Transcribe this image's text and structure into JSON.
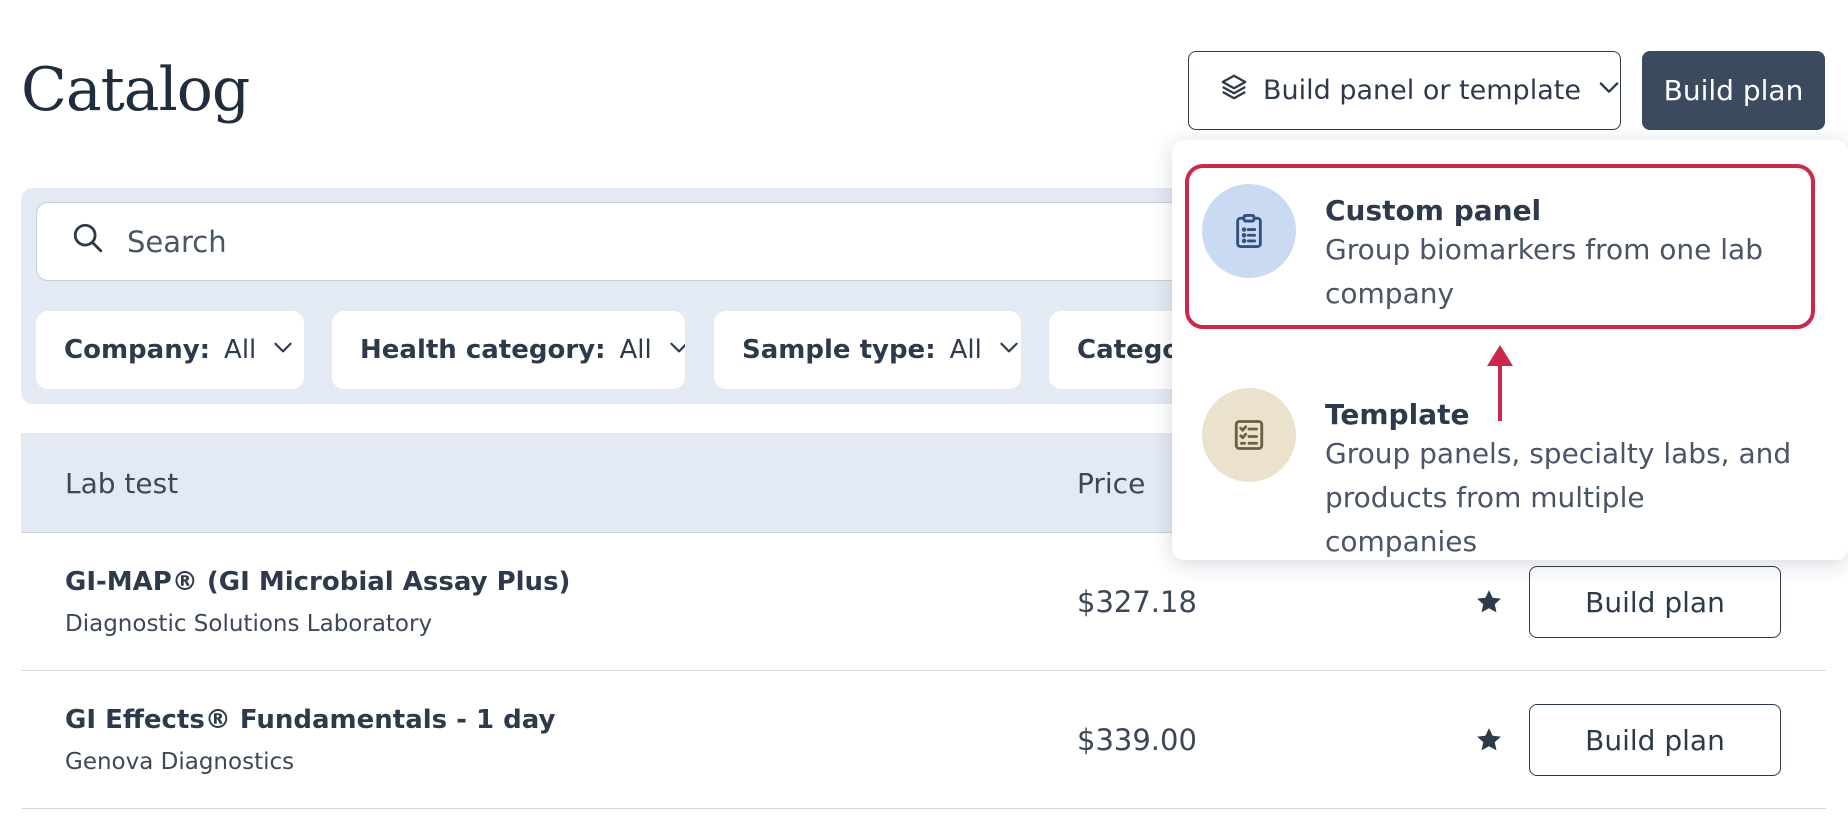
{
  "header": {
    "title": "Catalog",
    "build_panel_label": "Build panel or template",
    "build_plan_label": "Build plan"
  },
  "search": {
    "placeholder": "Search"
  },
  "filters": [
    {
      "label": "Company:",
      "value": "All"
    },
    {
      "label": "Health category:",
      "value": "All"
    },
    {
      "label": "Sample type:",
      "value": "All"
    },
    {
      "label": "Category",
      "value": ""
    }
  ],
  "table": {
    "columns": [
      "Lab test",
      "Price"
    ],
    "rows": [
      {
        "title": "GI-MAP® (GI Microbial Assay Plus)",
        "company": "Diagnostic Solutions Laboratory",
        "price": "$327.18",
        "button": "Build plan"
      },
      {
        "title": "GI Effects® Fundamentals - 1 day",
        "company": "Genova Diagnostics",
        "price": "$339.00",
        "button": "Build plan"
      }
    ]
  },
  "dropdown": {
    "items": [
      {
        "title": "Custom panel",
        "description": "Group biomarkers from one lab company",
        "icon": "clipboard-icon",
        "icon_bg": "#c9daf2"
      },
      {
        "title": "Template",
        "description": "Group panels, specialty labs, and products from multiple companies",
        "icon": "checklist-icon",
        "icon_bg": "#ebe2cd"
      }
    ]
  },
  "colors": {
    "accent_dark": "#3b4a5e",
    "highlight": "#cc2848",
    "panel_bg": "#e4eaf3"
  }
}
